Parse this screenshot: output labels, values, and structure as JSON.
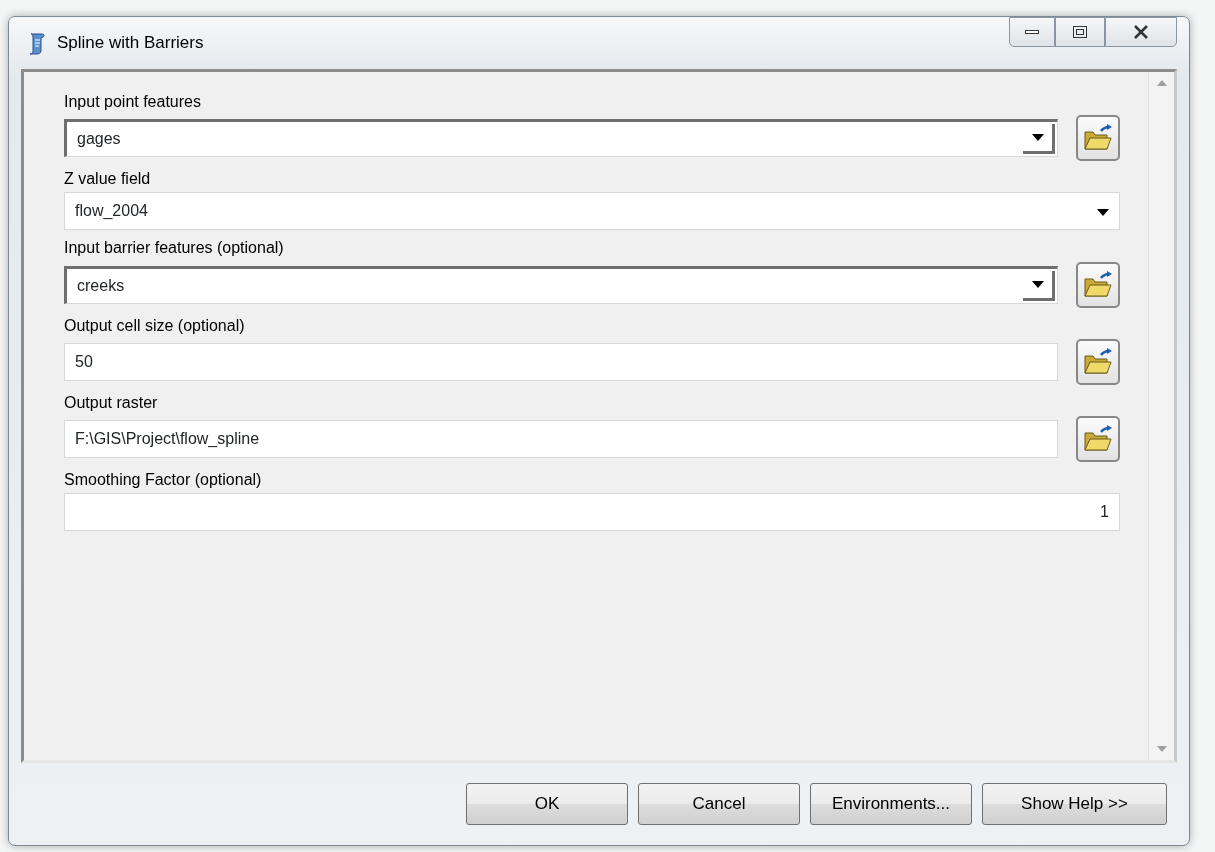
{
  "window": {
    "title": "Spline with Barriers"
  },
  "parameters": [
    {
      "label": "Input point features",
      "kind": "combo",
      "value": "gages",
      "browse": true
    },
    {
      "label": "Z value field",
      "kind": "select",
      "value": "flow_2004",
      "browse": false
    },
    {
      "label": "Input barrier features (optional)",
      "kind": "combo",
      "value": "creeks",
      "browse": true
    },
    {
      "label": "Output cell size (optional)",
      "kind": "text",
      "value": "50",
      "browse": true
    },
    {
      "label": "Output raster",
      "kind": "text",
      "value": "F:\\GIS\\Project\\flow_spline",
      "browse": true
    },
    {
      "label": "Smoothing Factor (optional)",
      "kind": "number",
      "value": "1",
      "browse": false
    }
  ],
  "buttons": [
    "OK",
    "Cancel",
    "Environments...",
    "Show Help >>"
  ]
}
